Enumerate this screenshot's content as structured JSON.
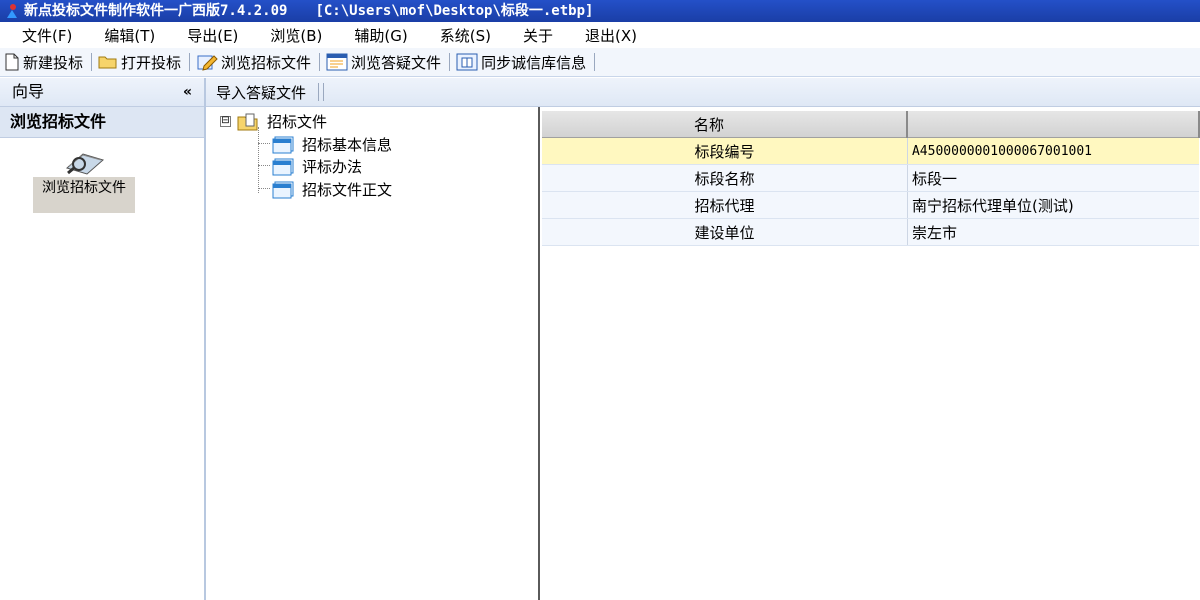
{
  "window": {
    "title": "新点投标文件制作软件一广西版7.4.2.09",
    "path": "[C:\\Users\\mof\\Desktop\\标段一.etbp]"
  },
  "menu": [
    "文件(F)",
    "编辑(T)",
    "导出(E)",
    "浏览(B)",
    "辅助(G)",
    "系统(S)",
    "关于",
    "退出(X)"
  ],
  "toolbar": {
    "new_bid": "新建投标",
    "open_bid": "打开投标",
    "browse_tender": "浏览招标文件",
    "browse_qa": "浏览答疑文件",
    "sync_credit": "同步诚信库信息"
  },
  "nav": {
    "header": "向导",
    "collapse": "«",
    "section": "浏览招标文件",
    "item_label": "浏览招标文件"
  },
  "midbar": {
    "import_qa": "导入答疑文件"
  },
  "tree": {
    "toggle": "⊟",
    "root": "招标文件",
    "children": [
      "招标基本信息",
      "评标办法",
      "招标文件正文"
    ]
  },
  "grid": {
    "headers": [
      "名称",
      ""
    ],
    "rows": [
      {
        "name": "标段编号",
        "value": "A4500000001000067001001"
      },
      {
        "name": "标段名称",
        "value": "标段一"
      },
      {
        "name": "招标代理",
        "value": "南宁招标代理单位(测试)"
      },
      {
        "name": "建设单位",
        "value": "崇左市"
      }
    ]
  }
}
